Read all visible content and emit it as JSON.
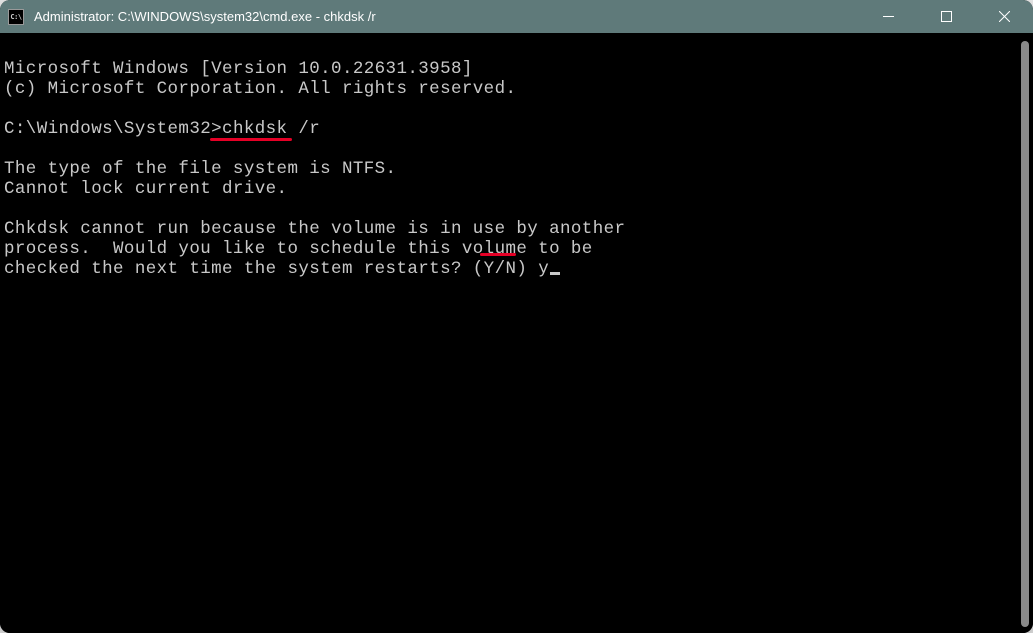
{
  "window": {
    "icon_text": "C:\\",
    "title": "Administrator: C:\\WINDOWS\\system32\\cmd.exe - chkdsk  /r"
  },
  "terminal": {
    "line1": "Microsoft Windows [Version 10.0.22631.3958]",
    "line2": "(c) Microsoft Corporation. All rights reserved.",
    "blank1": "",
    "prompt_prefix": "C:\\Windows\\System32>",
    "prompt_cmd": "chkdsk /r",
    "out1": "The type of the file system is NTFS.",
    "out2": "Cannot lock current drive.",
    "blank2": "",
    "out3": "Chkdsk cannot run because the volume is in use by another",
    "out4": "process.  Would you like to schedule this volume to be",
    "out5_prefix": "checked the next time the system restarts? (Y/N) ",
    "out5_input": "y"
  }
}
